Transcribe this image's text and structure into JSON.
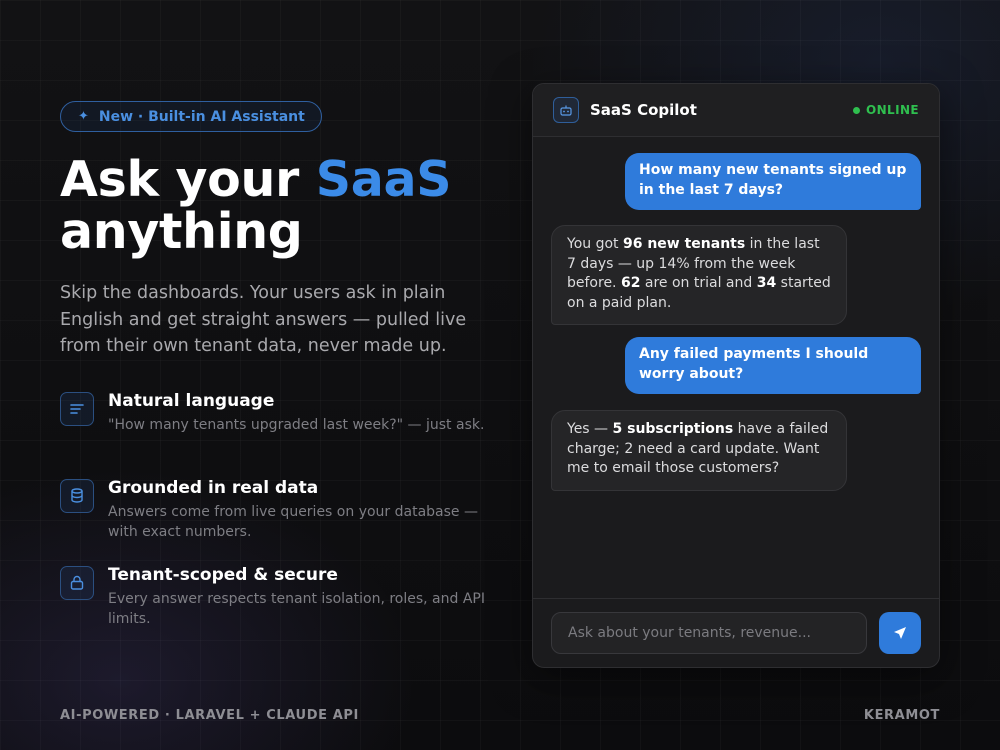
{
  "badge": {
    "icon": "sparkle-icon",
    "text": "New · Built-in AI Assistant"
  },
  "hero": {
    "title_part1": "Ask your ",
    "title_accent": "SaaS",
    "title_part2": "anything",
    "subtitle": "Skip the dashboards. Your users ask in plain English and get straight answers — pulled live from their own tenant data, never made up."
  },
  "features": [
    {
      "icon": "lines-icon",
      "title": "Natural language",
      "desc": "\"How many tenants upgraded last week?\" — just ask."
    },
    {
      "icon": "database-icon",
      "title": "Grounded in real data",
      "desc": "Answers come from live queries on your database — with exact numbers."
    },
    {
      "icon": "lock-icon",
      "title": "Tenant-scoped & secure",
      "desc": "Every answer respects tenant isolation, roles, and API limits."
    }
  ],
  "chat": {
    "title": "SaaS Copilot",
    "status": "ONLINE",
    "messages": [
      {
        "role": "user",
        "text": "How many new tenants signed up in the last 7 days?"
      },
      {
        "role": "assistant",
        "t1": "You got ",
        "b1": "96 new tenants",
        "t2": " in the last 7 days — up 14% from the week before. ",
        "b2": "62",
        "t3": " are on trial and ",
        "b3": "34",
        "t4": " started on a paid plan."
      },
      {
        "role": "user",
        "text": "Any failed payments I should worry about?"
      },
      {
        "role": "assistant",
        "t1": "Yes — ",
        "b1": "5 subscriptions",
        "t2": " have a failed charge; 2 need a card update. Want me to email those customers?"
      }
    ],
    "input_placeholder": "Ask about your tenants, revenue...",
    "send_icon": "send-icon"
  },
  "footer": {
    "left": "AI-POWERED · LARAVEL + CLAUDE API",
    "right": "KERAMOT"
  },
  "colors": {
    "accent": "#3b8be8",
    "user_bubble": "#2f7bdb",
    "online": "#2fbf4f"
  }
}
